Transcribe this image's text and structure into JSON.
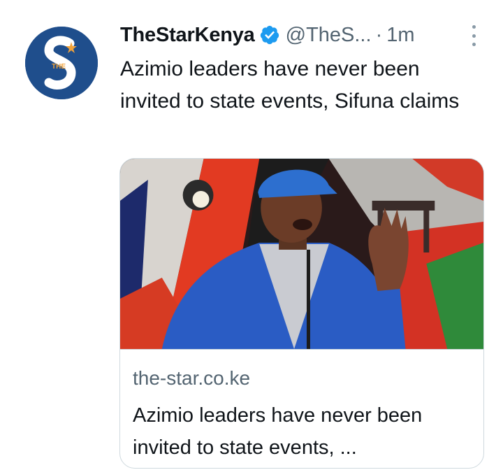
{
  "tweet": {
    "author": {
      "display_name": "TheStarKenya",
      "verified_icon": "verified-badge-icon",
      "handle": "@TheS...",
      "avatar_text": "THE"
    },
    "separator": "·",
    "time": "1m",
    "text": "Azimio leaders have never been invited to state events, Sifuna claims",
    "card": {
      "domain": "the-star.co.ke",
      "title": "Azimio leaders have never been invited to state events, ..."
    }
  },
  "colors": {
    "avatar_bg": "#1f4e8c",
    "verified": "#1d9bf0",
    "secondary_text": "#536471",
    "border": "#cfd9de"
  }
}
